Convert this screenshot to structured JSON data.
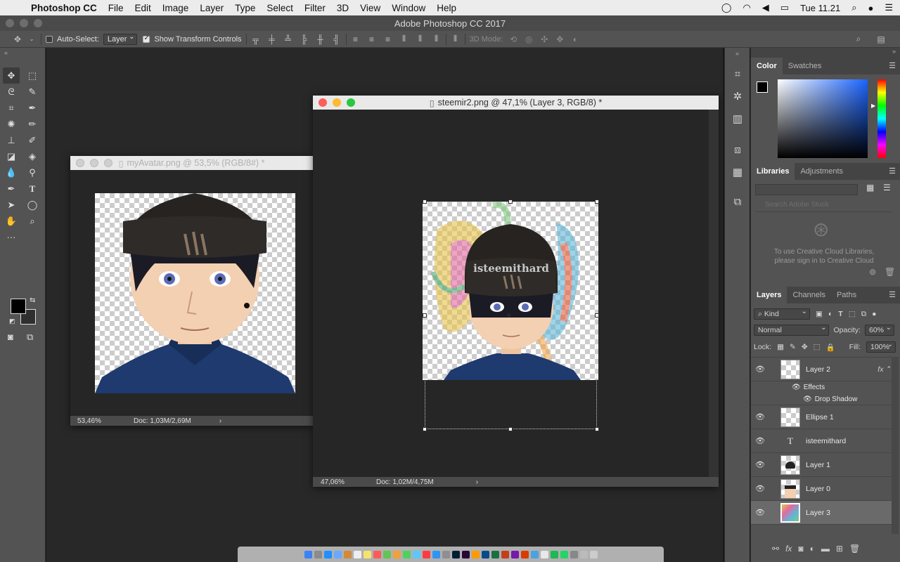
{
  "menubar": {
    "app": "Photoshop CC",
    "items": [
      "File",
      "Edit",
      "Image",
      "Layer",
      "Type",
      "Select",
      "Filter",
      "3D",
      "View",
      "Window",
      "Help"
    ],
    "clock": "Tue 11.21"
  },
  "window_title": "Adobe Photoshop CC 2017",
  "options": {
    "auto_select_label": "Auto-Select:",
    "auto_select_value": "Layer",
    "show_transform_label": "Show Transform Controls",
    "mode_3d_label": "3D Mode:"
  },
  "doc1": {
    "title": "myAvatar.png @ 53,5% (RGB/8#) *",
    "zoom": "53,46%",
    "doc_size": "Doc: 1,03M/2,69M"
  },
  "doc2": {
    "title": "steemir2.png @ 47,1% (Layer 3, RGB/8) *",
    "zoom": "47,06%",
    "doc_size": "Doc: 1,02M/4,75M",
    "hat_text": "isteemithard"
  },
  "color_panel": {
    "tabs": [
      "Color",
      "Swatches"
    ]
  },
  "libraries_panel": {
    "tabs": [
      "Libraries",
      "Adjustments"
    ],
    "search_placeholder": "Search Adobe Stock",
    "message": "To use Creative Cloud Libraries, please sign in to Creative Cloud"
  },
  "layers_panel": {
    "tabs": [
      "Layers",
      "Channels",
      "Paths"
    ],
    "filter": "Kind",
    "blend_mode": "Normal",
    "opacity_label": "Opacity:",
    "opacity_value": "60%",
    "lock_label": "Lock:",
    "fill_label": "Fill:",
    "fill_value": "100%",
    "layers": [
      {
        "name": "Layer 2",
        "fx": "fx"
      },
      {
        "name": "Effects"
      },
      {
        "name": "Drop Shadow"
      },
      {
        "name": "Ellipse 1"
      },
      {
        "name": "isteemithard"
      },
      {
        "name": "Layer 1"
      },
      {
        "name": "Layer 0"
      },
      {
        "name": "Layer 3"
      }
    ]
  },
  "colors": {
    "accent": "#4a4a4a",
    "panel": "#535353"
  }
}
